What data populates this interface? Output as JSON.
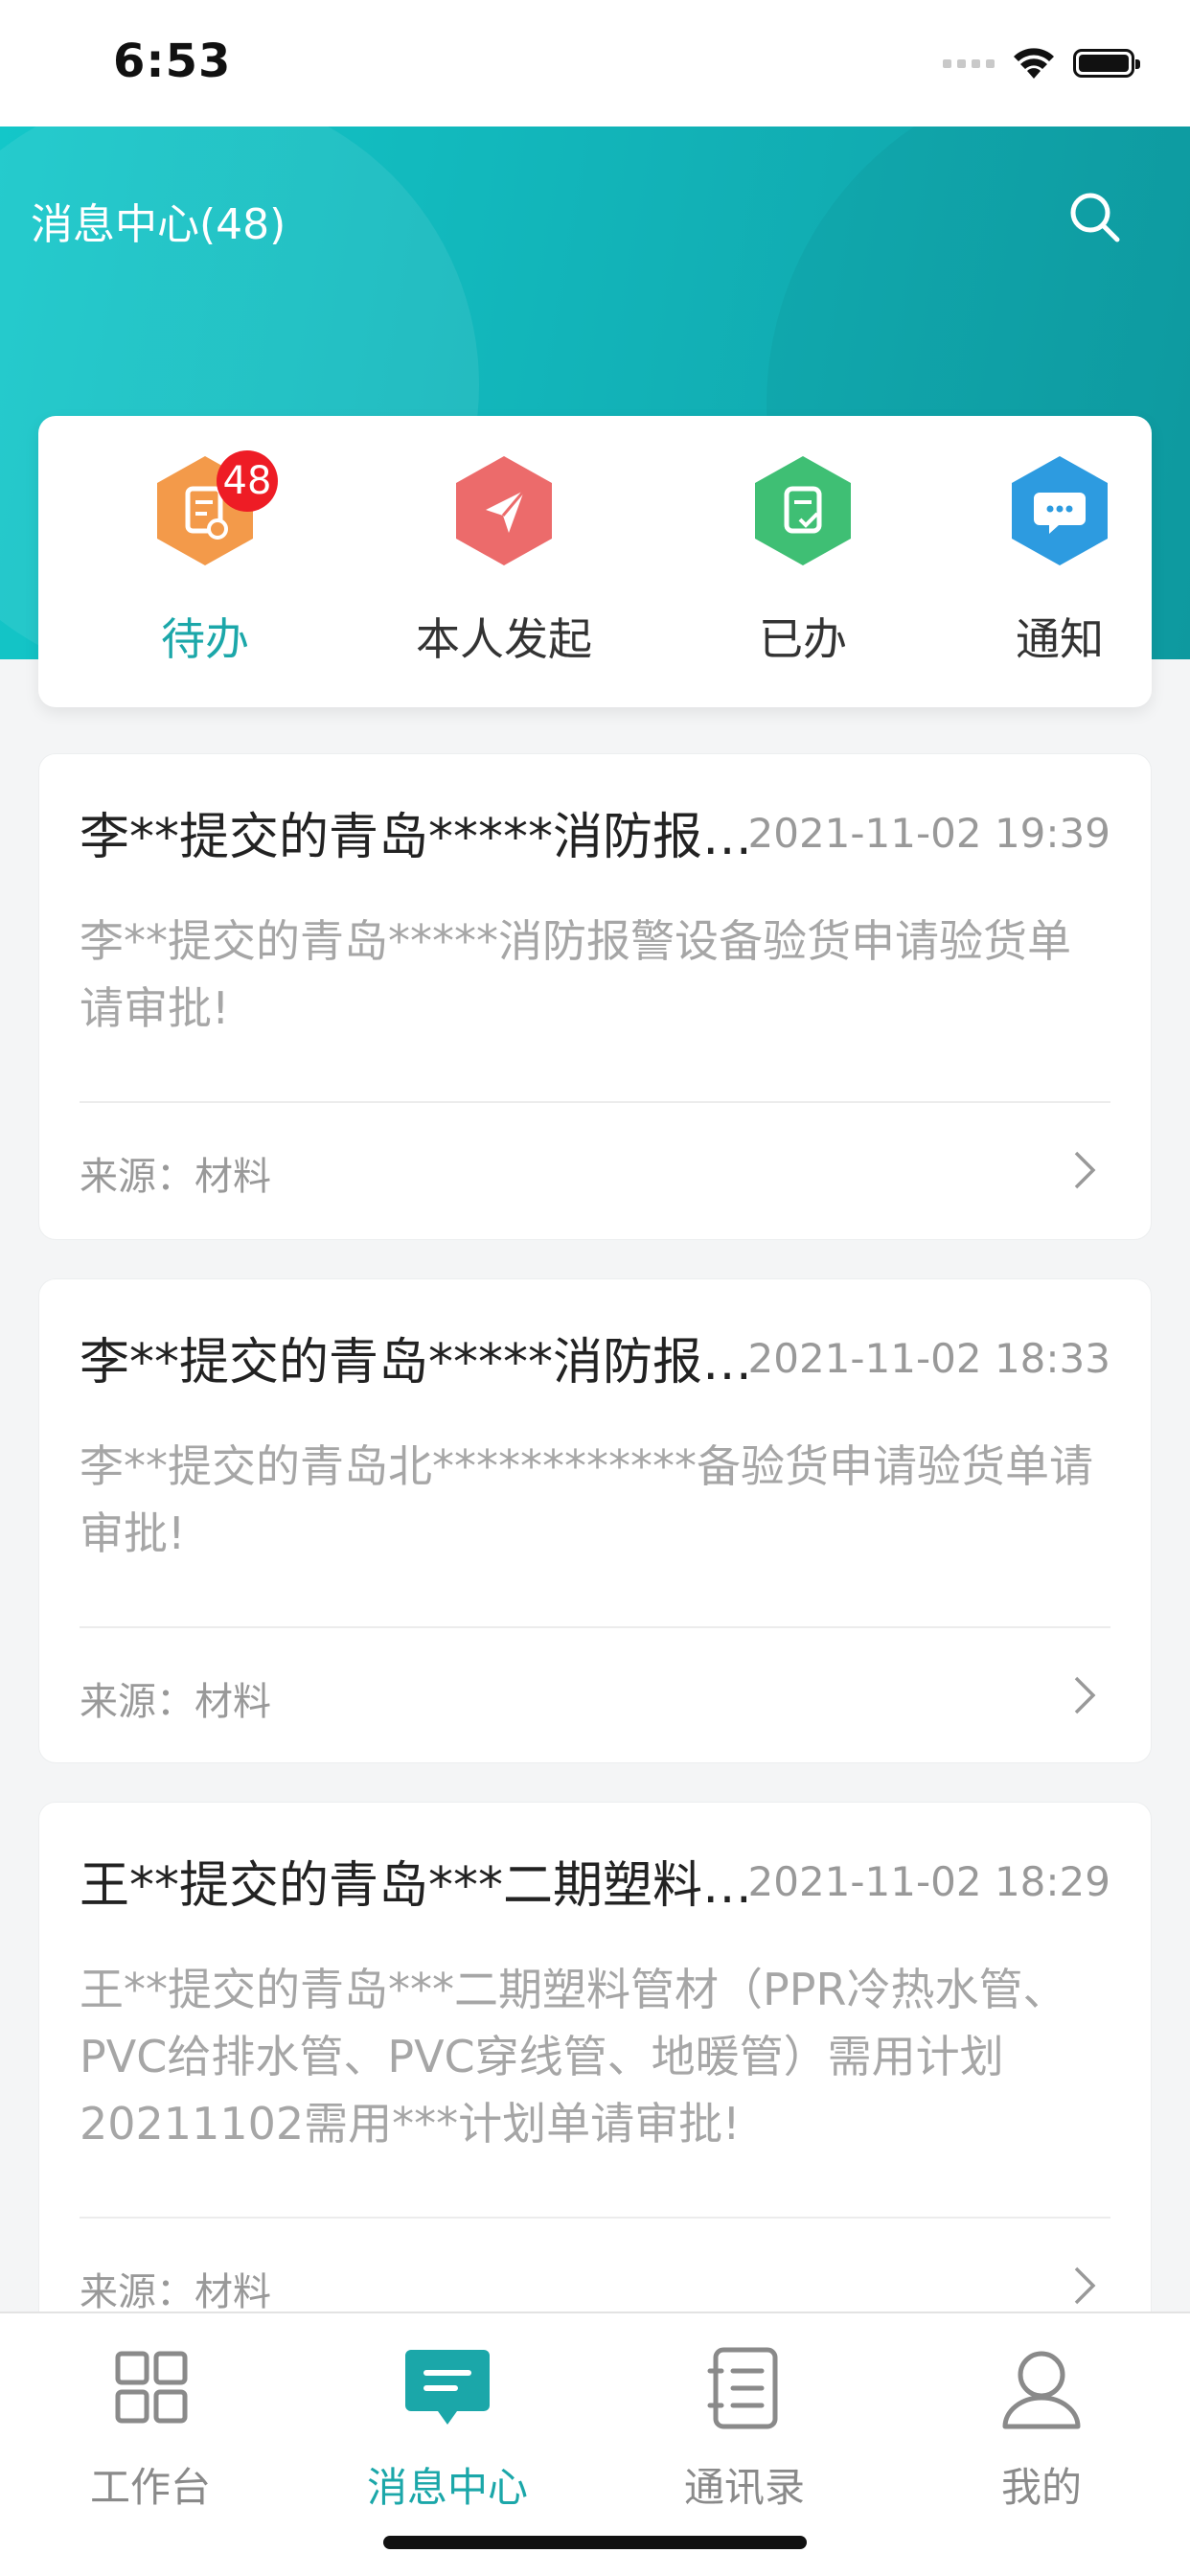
{
  "status_bar": {
    "time": "6:53"
  },
  "header": {
    "title": "消息中心(48)"
  },
  "quick_tabs": [
    {
      "label": "待办",
      "icon": "todo-icon",
      "badge": "48",
      "active": true,
      "color": "#f39a4a"
    },
    {
      "label": "本人发起",
      "icon": "send-icon",
      "active": false,
      "color": "#ec6b6b"
    },
    {
      "label": "已办",
      "icon": "done-icon",
      "active": false,
      "color": "#3fbf74"
    },
    {
      "label": "通知",
      "icon": "notice-icon",
      "active": false,
      "color": "#2d9be0"
    }
  ],
  "messages": [
    {
      "title": "李**提交的青岛*****消防报警设备验货申请验货单请审批!",
      "time": "2021-11-02 19:39",
      "body": "李**提交的青岛*****消防报警设备验货申请验货单请审批!",
      "source": "来源：材料"
    },
    {
      "title": "李**提交的青岛*****消防报警设备验货申请验货单请审批!",
      "time": "2021-11-02 18:33",
      "body": "李**提交的青岛北************备验货申请验货单请审批!",
      "source": "来源：材料"
    },
    {
      "title": "王**提交的青岛***二期塑料管材计划单请审批!",
      "time": "2021-11-02 18:29",
      "body": "王**提交的青岛***二期塑料管材（PPR冷热水管、PVC给排水管、PVC穿线管、地暖管）需用计划20211102需用***计划单请审批!",
      "source": "来源：材料"
    }
  ],
  "tab_bar": [
    {
      "label": "工作台",
      "icon": "workbench-icon",
      "active": false
    },
    {
      "label": "消息中心",
      "icon": "message-center-icon",
      "active": true
    },
    {
      "label": "通讯录",
      "icon": "contacts-icon",
      "active": false
    },
    {
      "label": "我的",
      "icon": "profile-icon",
      "active": false
    }
  ],
  "colors": {
    "accent": "#1ba7a9",
    "badge": "#ee1c25",
    "header_start": "#13c7c9",
    "header_end": "#0fa0a6"
  }
}
